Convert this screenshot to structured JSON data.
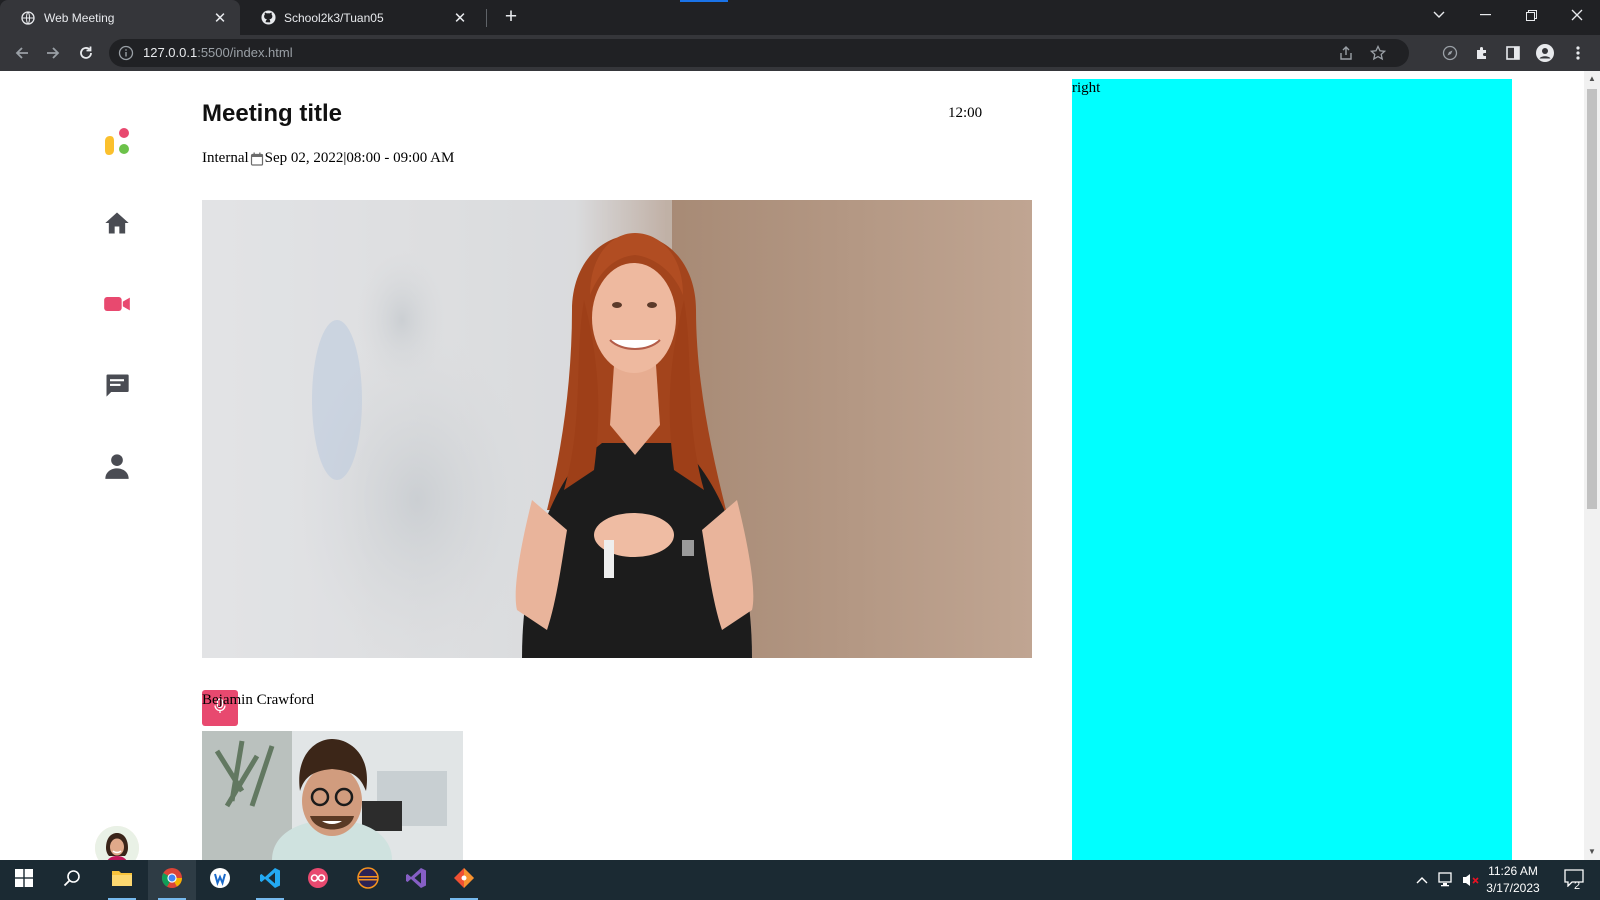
{
  "browser": {
    "tabs": [
      {
        "title": "Web Meeting",
        "active": true,
        "icon": "globe-icon"
      },
      {
        "title": "School2k3/Tuan05",
        "active": false,
        "icon": "github-icon"
      }
    ],
    "url_host": "127.0.0.1",
    "url_rest": ":5500/index.html"
  },
  "page": {
    "meeting_title": "Meeting title",
    "time": "12:00",
    "meta": {
      "type": "Internal",
      "date": "Sep 02, 2022",
      "separator": "|",
      "time_range": "08:00 - 09:00 AM"
    },
    "participant_name": "Bejamin Crawford",
    "right_label": "right",
    "colors": {
      "accent": "#e8496f",
      "nav_icon": "#4a4c53",
      "right_panel": "#00ffff"
    },
    "sidebar_icons": [
      "logo-icon",
      "home-icon",
      "video-camera-icon",
      "chat-icon",
      "person-icon"
    ]
  },
  "taskbar": {
    "time": "11:26 AM",
    "date": "3/17/2023",
    "notification_count": "2",
    "apps": [
      "start-icon",
      "search-icon",
      "file-explorer-icon",
      "chrome-icon",
      "app-icon",
      "vscode-icon",
      "app-icon",
      "eclipse-icon",
      "visual-studio-icon",
      "git-icon"
    ]
  }
}
